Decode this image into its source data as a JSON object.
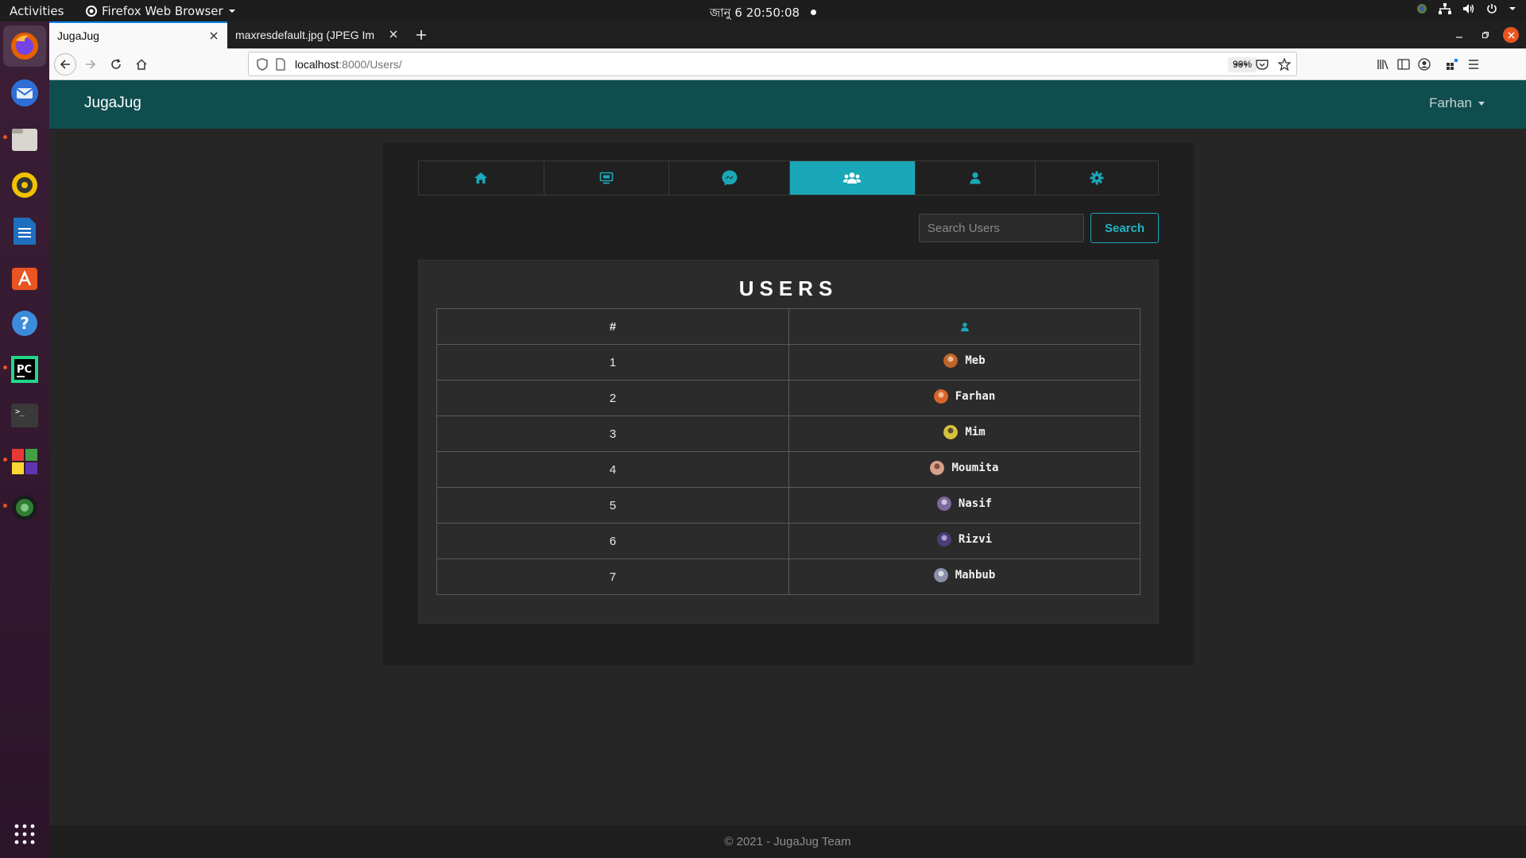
{
  "os": {
    "activities_label": "Activities",
    "app_menu_label": "Firefox Web Browser",
    "clock": "জানু 6  20:50:08"
  },
  "browser": {
    "tabs": [
      {
        "label": "JugaJug",
        "active": true
      },
      {
        "label": "maxresdefault.jpg (JPEG Im",
        "active": false
      }
    ],
    "url_host": "localhost",
    "url_path": ":8000/Users/",
    "zoom": "90%"
  },
  "site": {
    "brand": "JugaJug",
    "user_menu_label": "Farhan",
    "nav_tabs": [
      {
        "icon": "home-icon",
        "active": false
      },
      {
        "icon": "monitor-icon",
        "active": false
      },
      {
        "icon": "messenger-icon",
        "active": false
      },
      {
        "icon": "users-icon",
        "active": true
      },
      {
        "icon": "user-icon",
        "active": false
      },
      {
        "icon": "gear-icon",
        "active": false
      }
    ],
    "search": {
      "placeholder": "Search Users",
      "button_label": "Search"
    },
    "users_title": "USERS",
    "table": {
      "header_num": "#",
      "header_user_icon": "user-icon",
      "rows": [
        {
          "num": "1",
          "name": "Meb",
          "avatar_color": "#c0652b"
        },
        {
          "num": "2",
          "name": "Farhan",
          "avatar_color": "#d9642c"
        },
        {
          "num": "3",
          "name": "Mim",
          "avatar_color": "#d8c23a"
        },
        {
          "num": "4",
          "name": "Moumita",
          "avatar_color": "#d9a08a"
        },
        {
          "num": "5",
          "name": "Nasif",
          "avatar_color": "#7a6a9a"
        },
        {
          "num": "6",
          "name": "Rizvi",
          "avatar_color": "#4b3f78"
        },
        {
          "num": "7",
          "name": "Mahbub",
          "avatar_color": "#8a90a8"
        }
      ]
    },
    "footer": "© 2021 - JugaJug Team"
  },
  "colors": {
    "accent": "#1aa8b8",
    "navbar": "#0f4d4f",
    "background": "#262626"
  }
}
